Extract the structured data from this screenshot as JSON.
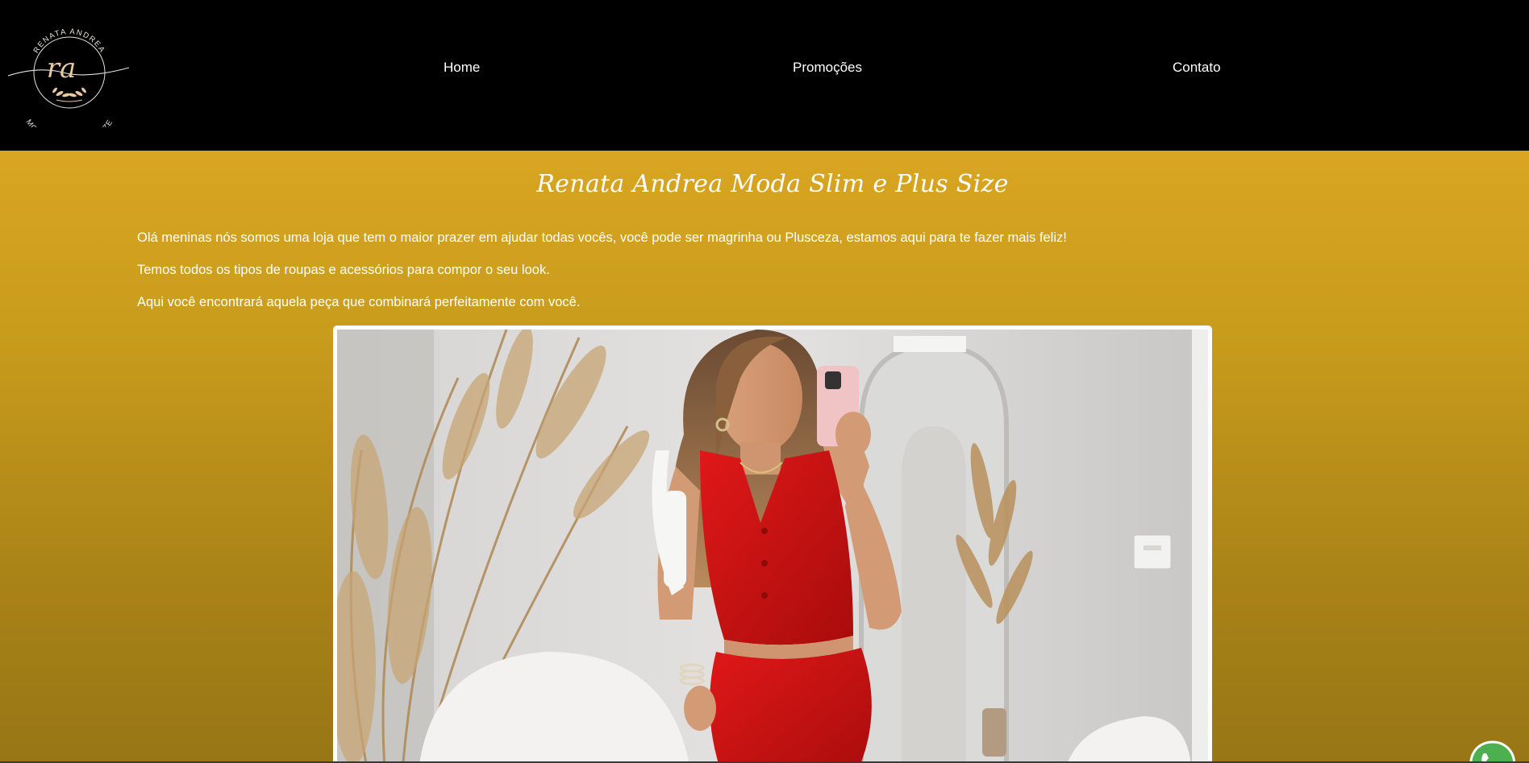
{
  "header": {
    "logo": {
      "top_text": "RENATA ANDREA",
      "monogram": "ra",
      "bottom_text": "MODA SLIM & PLUS SIZE"
    },
    "nav": [
      {
        "label": "Home"
      },
      {
        "label": "Promoções"
      },
      {
        "label": "Contato"
      }
    ]
  },
  "main": {
    "title": "Renata Andrea Moda Slim e Plus Size",
    "paragraphs": [
      "Olá meninas nós somos uma loja que tem o maior prazer em ajudar todas vocês, você pode ser magrinha ou Plusceza, estamos aqui para te fazer mais feliz!",
      "Temos todos os tipos de roupas e acessórios para compor o seu look.",
      "Aqui você encontrará aquela peça que combinará perfeitamente com você."
    ]
  },
  "floating": {
    "whatsapp_icon": "whatsapp-icon"
  },
  "colors": {
    "header_bg": "#000000",
    "gold_top": "#d9a522",
    "gold_bottom": "#987616",
    "whatsapp_green": "#4caf50"
  }
}
